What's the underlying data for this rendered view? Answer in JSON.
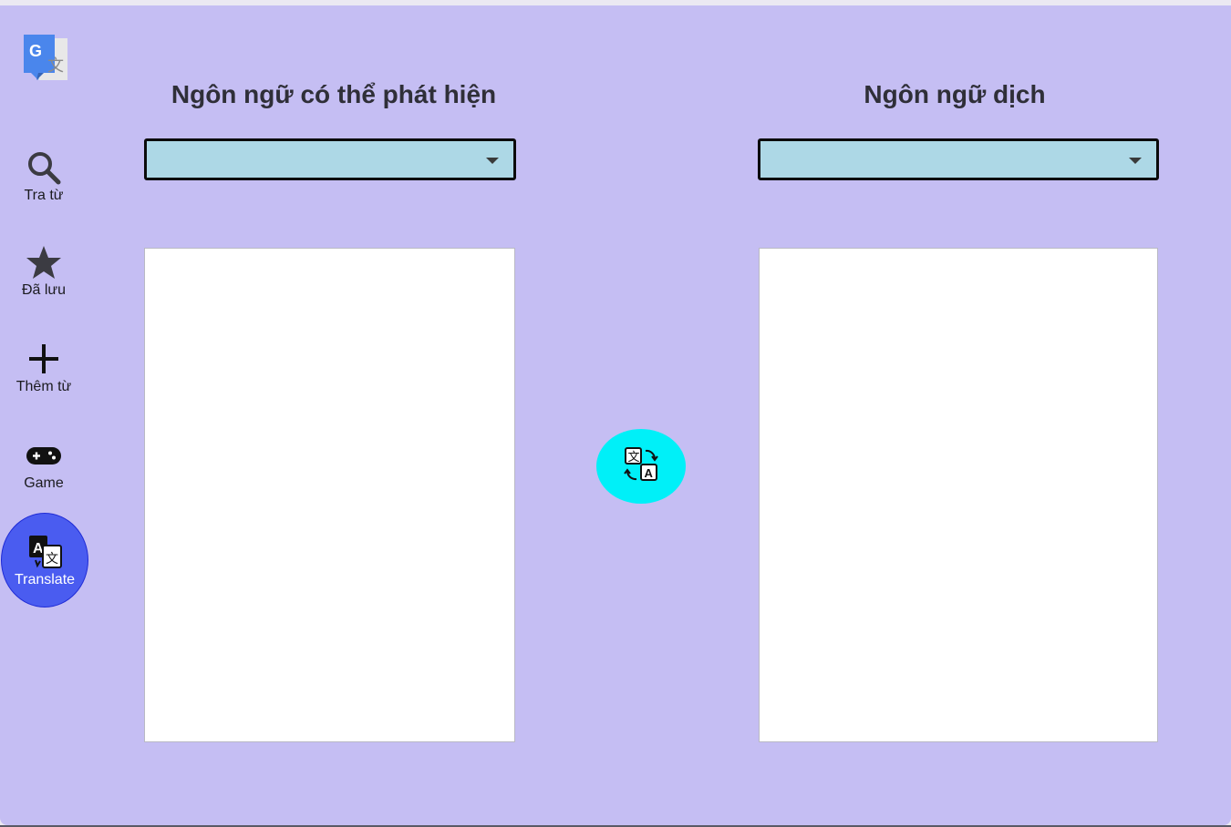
{
  "sidebar": {
    "logo_icon": "google-translate-logo",
    "items": [
      {
        "label": "Tra từ",
        "icon": "search-icon"
      },
      {
        "label": "Đã lưu",
        "icon": "star-icon"
      },
      {
        "label": "Thêm từ",
        "icon": "plus-icon"
      },
      {
        "label": "Game",
        "icon": "gamepad-icon"
      },
      {
        "label": "Translate",
        "icon": "translate-icon",
        "active": true
      }
    ]
  },
  "source": {
    "heading": "Ngôn ngữ có thể phát hiện",
    "selected_language": "",
    "text": ""
  },
  "target": {
    "heading": "Ngôn ngữ dịch",
    "selected_language": "",
    "text": ""
  },
  "translate_button": {
    "icon": "translate-swap-icon"
  },
  "colors": {
    "background": "#c5bef3",
    "select_fill": "#add8e6",
    "translate_button": "#00f0f8",
    "active_nav": "#4a5cf0"
  }
}
